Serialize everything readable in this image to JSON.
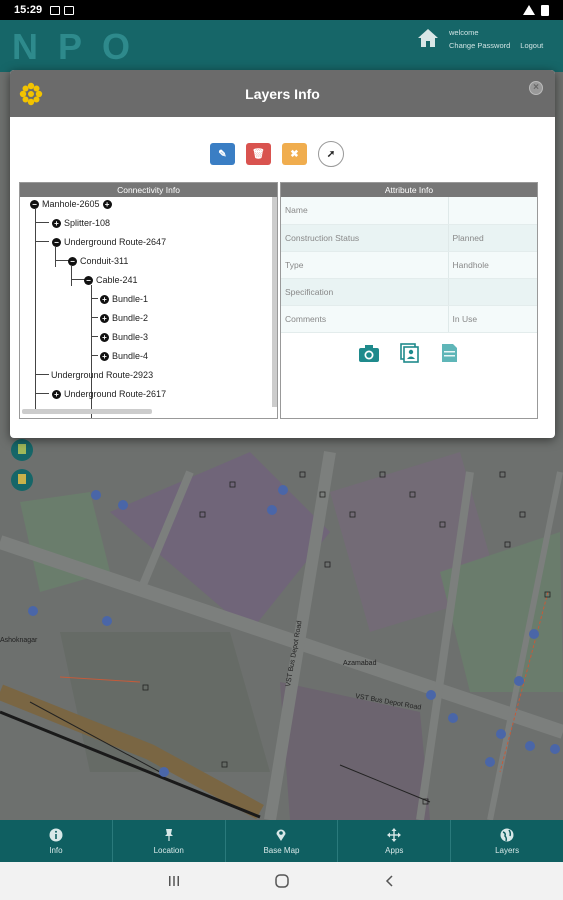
{
  "status_bar": {
    "time": "15:29"
  },
  "header": {
    "logo": "NPO",
    "welcome": "welcome",
    "change_password": "Change Password",
    "logout": "Logout"
  },
  "dialog": {
    "title": "Layers Info",
    "close": "×",
    "tools": [
      {
        "name": "edit",
        "color": "#3a7ec4",
        "glyph": "✎"
      },
      {
        "name": "delete",
        "color": "#d9534f",
        "glyph": "🗑"
      },
      {
        "name": "cancel",
        "color": "#f0ad4e",
        "glyph": "✖"
      },
      {
        "name": "select",
        "color": "#ffffff",
        "glyph": "➚"
      }
    ],
    "connectivity": {
      "heading": "Connectivity Info",
      "nodes": [
        {
          "label": "Manhole-2605",
          "toggle": "−",
          "after_toggle": "+"
        },
        {
          "label": "Splitter-108",
          "toggle": "+"
        },
        {
          "label": "Underground Route-2647",
          "toggle": "−"
        },
        {
          "label": "Conduit-311",
          "toggle": "−"
        },
        {
          "label": "Cable-241",
          "toggle": "−"
        },
        {
          "label": "Bundle-1",
          "toggle": "+"
        },
        {
          "label": "Bundle-2",
          "toggle": "+"
        },
        {
          "label": "Bundle-3",
          "toggle": "+"
        },
        {
          "label": "Bundle-4",
          "toggle": "+"
        },
        {
          "label": "Underground Route-2923",
          "toggle": ""
        },
        {
          "label": "Underground Route-2617",
          "toggle": "+"
        }
      ]
    },
    "attribute": {
      "heading": "Attribute Info",
      "rows": [
        {
          "key": "Name",
          "value": ""
        },
        {
          "key": "Construction Status",
          "value": "Planned"
        },
        {
          "key": "Type",
          "value": "Handhole"
        },
        {
          "key": "Specification",
          "value": ""
        },
        {
          "key": "Comments",
          "value": "In Use"
        }
      ],
      "icons": [
        "camera-icon",
        "contact-card-icon",
        "document-icon"
      ]
    }
  },
  "map": {
    "labels": [
      "VST Bus Depot Road",
      "VST Bus Depot Road",
      "Azamabad",
      "Ashoknagar"
    ]
  },
  "bottom_nav": [
    {
      "label": "Info",
      "icon": "info-icon"
    },
    {
      "label": "Location",
      "icon": "pin-icon"
    },
    {
      "label": "Base Map",
      "icon": "map-marker-icon"
    },
    {
      "label": "Apps",
      "icon": "move-icon"
    },
    {
      "label": "Layers",
      "icon": "globe-icon"
    }
  ],
  "colors": {
    "teal": "#166668",
    "dialog_header": "#6b6b6b"
  }
}
